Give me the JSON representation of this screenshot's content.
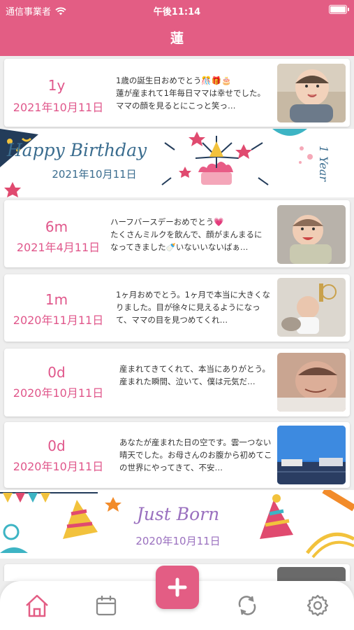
{
  "status_bar": {
    "carrier": "通信事業者",
    "time": "午後11:14"
  },
  "header": {
    "title": "蓮"
  },
  "entries": [
    {
      "age": "1y",
      "date": "2021年10月11日",
      "text": "1歳の誕生日おめでとう🎊🎁🎂\n蓮が産まれて1年毎日ママは幸せでした。ママの顔を見るとにこっと笑っ…"
    },
    {
      "age": "6m",
      "date": "2021年4月11日",
      "text": "ハーフバースデーおめでとう💗\nたくさんミルクを飲んで、顔がまんまるになってきました🍼いないいないばぁ…"
    },
    {
      "age": "1m",
      "date": "2020年11月11日",
      "text": "1ヶ月おめでとう。1ヶ月で本当に大きくなりました。目が徐々に見えるようになって、ママの目を見つめてくれ…"
    },
    {
      "age": "0d",
      "date": "2020年10月11日",
      "text": "産まれてきてくれて、本当にありがとう。\n産まれた瞬間、泣いて、僕は元気だ…"
    },
    {
      "age": "0d",
      "date": "2020年10月11日",
      "text": "あなたが産まれた日の空です。雲一つない晴天でした。お母さんのお腹から初めてこの世界にやってきて、不安…"
    }
  ],
  "banners": [
    {
      "title": "Happy Birthday",
      "date": "2021年10月11日",
      "side": "1 Year",
      "color": "#3b6d8f"
    },
    {
      "title": "Just Born",
      "date": "2020年10月11日",
      "color": "#9a70bf"
    }
  ],
  "tabs": [
    "home-icon",
    "calendar-icon",
    "add-icon",
    "sync-icon",
    "settings-icon"
  ],
  "colors": {
    "accent": "#e35d84",
    "age_text": "#e0578b",
    "tab_active": "#e35d84",
    "tab_inactive": "#8a8a8a"
  }
}
